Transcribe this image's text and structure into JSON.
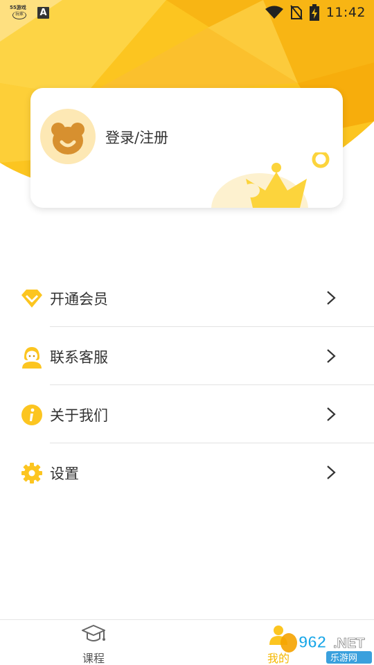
{
  "status_bar": {
    "app_badge_top": "55游戏",
    "app_badge_bottom": "玩家",
    "keyboard_indicator": "A",
    "time": "11:42"
  },
  "profile": {
    "login_label": "登录/注册"
  },
  "menu": {
    "items": [
      {
        "label": "开通会员",
        "icon": "diamond-icon"
      },
      {
        "label": "联系客服",
        "icon": "customer-service-icon"
      },
      {
        "label": "关于我们",
        "icon": "info-icon"
      },
      {
        "label": "设置",
        "icon": "gear-icon"
      }
    ]
  },
  "bottom_nav": {
    "courses_label": "课程",
    "mine_label": "我的"
  },
  "watermark": {
    "brand": "962.NET",
    "subtitle": "乐游网"
  },
  "colors": {
    "accent": "#fcc520",
    "accent_dark": "#f5a300",
    "avatar_bg": "#fde8b4",
    "bear": "#d7902f"
  }
}
